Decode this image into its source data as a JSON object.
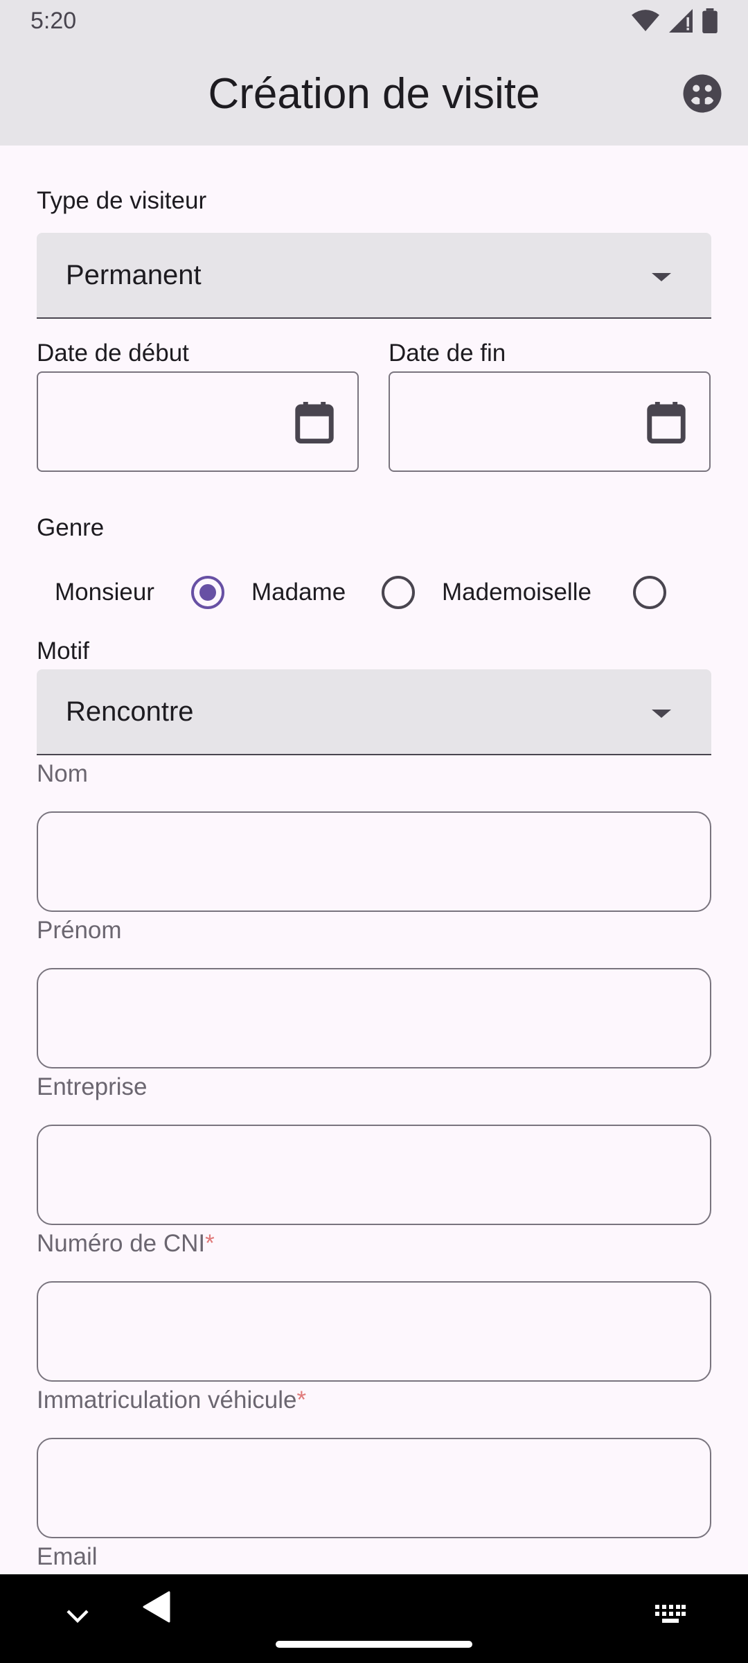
{
  "status_bar": {
    "time": "5:20"
  },
  "app_bar": {
    "title": "Création de visite",
    "action_icon": "face-icon"
  },
  "form": {
    "visitor_type": {
      "label": "Type de visiteur",
      "value": "Permanent"
    },
    "start_date": {
      "label": "Date de début",
      "value": ""
    },
    "end_date": {
      "label": "Date de fin",
      "value": ""
    },
    "gender": {
      "label": "Genre",
      "options": [
        {
          "label": "Monsieur",
          "checked": true
        },
        {
          "label": "Madame",
          "checked": false
        },
        {
          "label": "Mademoiselle",
          "checked": false
        }
      ]
    },
    "motif": {
      "label": "Motif",
      "value": "Rencontre"
    },
    "nom": {
      "label": "Nom",
      "value": ""
    },
    "prenom": {
      "label": "Prénom",
      "value": ""
    },
    "entreprise": {
      "label": "Entreprise",
      "value": ""
    },
    "cni": {
      "label": "Numéro de CNI",
      "required_mark": "*",
      "value": ""
    },
    "immatriculation": {
      "label": "Immatriculation véhicule",
      "required_mark": "*",
      "value": ""
    },
    "email": {
      "label": "Email"
    }
  },
  "colors": {
    "accent": "#6750a4",
    "background": "#fdf7fd",
    "app_bar": "#e6e4e8",
    "required": "#e07a7a"
  }
}
